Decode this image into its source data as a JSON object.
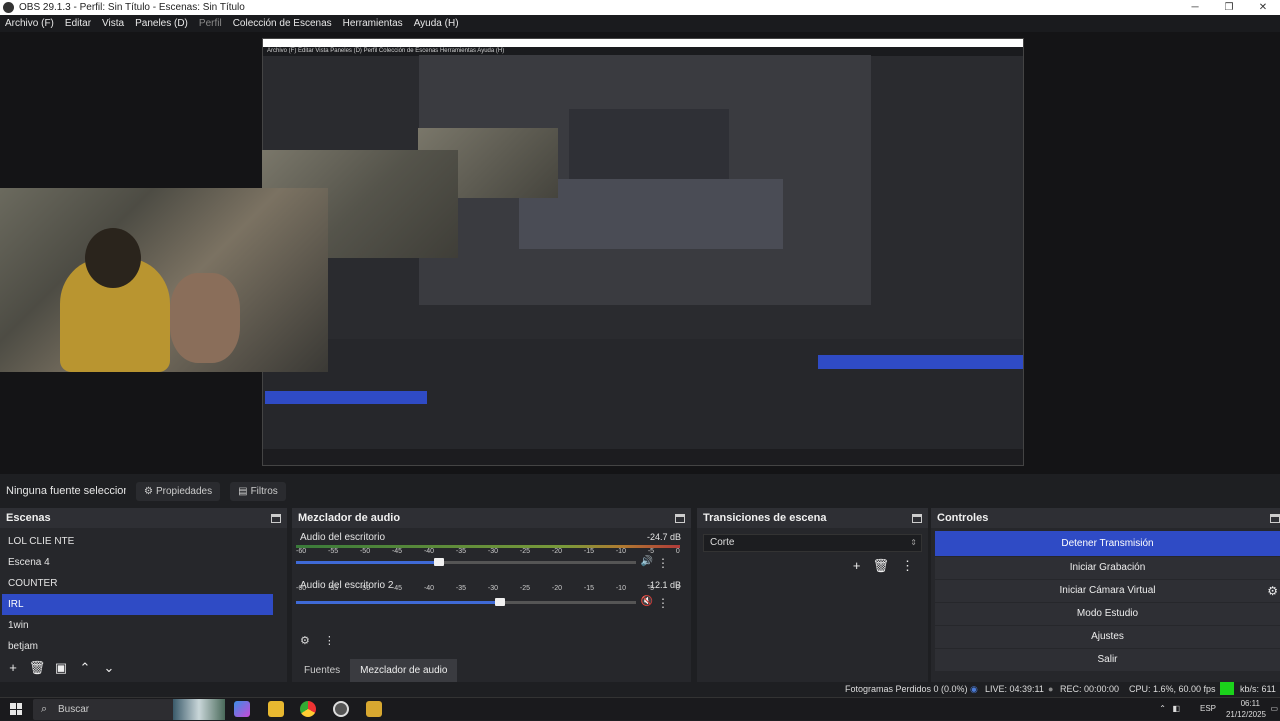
{
  "window": {
    "title": "OBS 29.1.3 - Perfil: Sin Título - Escenas: Sin Título",
    "controls": [
      "─",
      "❐",
      "✕"
    ]
  },
  "menu": {
    "items": [
      "Archivo (F)",
      "Editar",
      "Vista",
      "Paneles (D)",
      "Perfil",
      "Colección de Escenas",
      "Herramientas",
      "Ayuda (H)"
    ]
  },
  "source_bar": {
    "no_source": "Ninguna fuente seleccionac",
    "properties_label": "Propiedades",
    "filters_label": "Filtros"
  },
  "scenes": {
    "title": "Escenas",
    "items": [
      "LOL CLIE NTE",
      "Escena 4",
      "COUNTER",
      "IRL",
      "1win",
      "betjam"
    ],
    "selected_index": 3
  },
  "mixer": {
    "title": "Mezclador de audio",
    "ticks": [
      "-60",
      "-55",
      "-50",
      "-45",
      "-40",
      "-35",
      "-30",
      "-25",
      "-20",
      "-15",
      "-10",
      "-5",
      "0"
    ],
    "tracks": [
      {
        "name": "Audio del escritorio",
        "db": "-24.7 dB",
        "level": 0.42,
        "muted": false
      },
      {
        "name": "Audio del escritorio 2",
        "db": "-12.1 dB",
        "level": 0.6,
        "muted": true
      }
    ],
    "tabs": [
      "Fuentes",
      "Mezclador de audio"
    ],
    "active_tab": 1
  },
  "transitions": {
    "title": "Transiciones de escena",
    "selected": "Corte"
  },
  "controls": {
    "title": "Controles",
    "buttons": [
      "Detener Transmisión",
      "Iniciar Grabación",
      "Iniciar Cámara Virtual",
      "Modo Estudio",
      "Ajustes",
      "Salir"
    ]
  },
  "status": {
    "dropped": "Fotogramas Perdidos 0 (0.0%)",
    "live": "LIVE: 04:39:11",
    "rec": "REC: 00:00:00",
    "cpu": "CPU: 1.6%, 60.00 fps",
    "kbps": "kb/s: 611"
  },
  "taskbar": {
    "search_placeholder": "Buscar",
    "language": "ESP",
    "time": "06:11",
    "date": "21/12/2025"
  },
  "preview_nested": {
    "menu_text": "Archivo (F)  Editar  Vista  Paneles (D)  Perfil  Colección de Escenas  Herramientas  Ayuda (H)"
  }
}
